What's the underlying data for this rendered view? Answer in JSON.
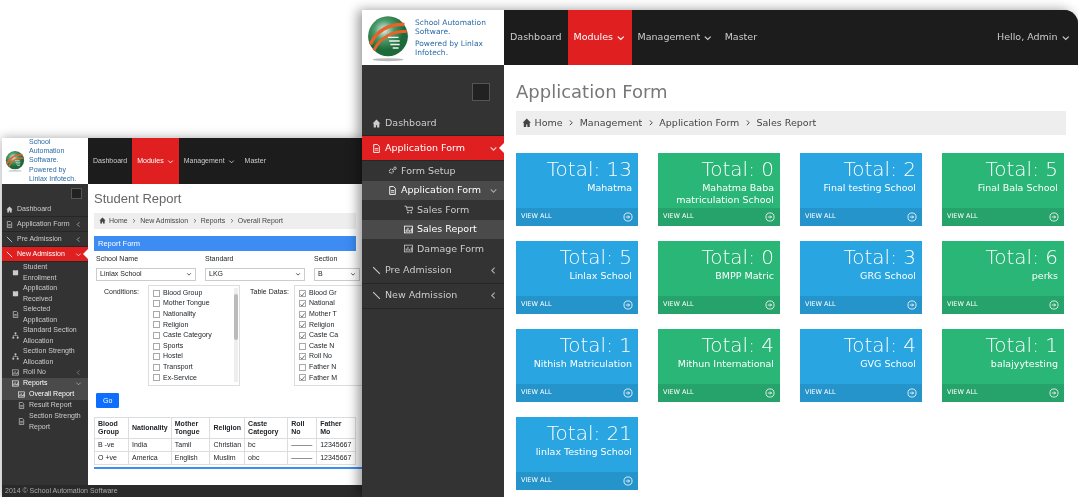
{
  "back_window": {
    "logo": {
      "title": "School Automation Software.",
      "subtitle": "Powered by Linlax Infotech."
    },
    "nav": [
      {
        "label": "Dashboard",
        "selected": false,
        "dropdown": false
      },
      {
        "label": "Modules",
        "selected": true,
        "dropdown": true
      },
      {
        "label": "Management",
        "selected": false,
        "dropdown": true
      },
      {
        "label": "Master",
        "selected": false,
        "dropdown": false
      }
    ],
    "sidebar": [
      {
        "label": "Dashboard",
        "kind": "home",
        "selected": false
      },
      {
        "label": "Application Form",
        "kind": "doc",
        "selected": false,
        "expanded": false
      },
      {
        "label": "Pre Admission",
        "kind": "pen",
        "selected": false,
        "expanded": false
      },
      {
        "label": "New Admission",
        "kind": "pen",
        "selected": true,
        "expanded": true,
        "children": [
          {
            "label": "Student Enrollment",
            "kind": "book",
            "selected": false
          },
          {
            "label": "Application Received",
            "kind": "book",
            "selected": false
          },
          {
            "label": "Selected Application",
            "kind": "doc",
            "selected": false
          },
          {
            "label": "Standard Section Allocation",
            "kind": "tree",
            "selected": false
          },
          {
            "label": "Section Strength Allocation",
            "kind": "tree",
            "selected": false
          },
          {
            "label": "Roll No",
            "kind": "chart",
            "selected": false,
            "expanded": false
          },
          {
            "label": "Reports",
            "kind": "chart",
            "selected": true,
            "expanded": true,
            "children": [
              {
                "label": "Overall Report",
                "kind": "chart",
                "selected": true
              },
              {
                "label": "Result Report",
                "kind": "doc",
                "selected": false
              },
              {
                "label": "Section Strength Report",
                "kind": "doc",
                "selected": false
              }
            ]
          }
        ]
      }
    ],
    "page_title": "Student Report",
    "breadcrumb": [
      "Home",
      "New Admission",
      "Reports",
      "Overall Report"
    ],
    "report_form": {
      "title": "Report Form",
      "fields": [
        {
          "label": "School Name",
          "value": "Linlax School"
        },
        {
          "label": "Standard",
          "value": "LKG"
        },
        {
          "label": "Section",
          "value": "B"
        }
      ],
      "conditions": {
        "label": "Conditions:",
        "options": [
          {
            "label": "Blood Group",
            "checked": false
          },
          {
            "label": "Mother Tongue",
            "checked": false
          },
          {
            "label": "Nationality",
            "checked": false
          },
          {
            "label": "Religion",
            "checked": false
          },
          {
            "label": "Caste Category",
            "checked": false
          },
          {
            "label": "Sports",
            "checked": false
          },
          {
            "label": "Hostel",
            "checked": false
          },
          {
            "label": "Transport",
            "checked": false
          },
          {
            "label": "Ex-Service",
            "checked": false
          }
        ]
      },
      "table_datas": {
        "label": "Table Datas:",
        "options": [
          {
            "label": "Blood Gr",
            "checked": true
          },
          {
            "label": "National",
            "checked": true
          },
          {
            "label": "Mother T",
            "checked": true
          },
          {
            "label": "Religion",
            "checked": true
          },
          {
            "label": "Caste Ca",
            "checked": true
          },
          {
            "label": "Caste N",
            "checked": false
          },
          {
            "label": "Roll No",
            "checked": true
          },
          {
            "label": "Father N",
            "checked": false
          },
          {
            "label": "Father M",
            "checked": true
          }
        ]
      },
      "button": "Go"
    },
    "table": {
      "columns": [
        "Blood Group",
        "Nationality",
        "Mother Tongue",
        "Religion",
        "Caste Category",
        "Roll No",
        "Father Mo"
      ],
      "rows": [
        [
          "B -ve",
          "India",
          "Tamil",
          "Christian",
          "bc",
          "———",
          "12345667"
        ],
        [
          "O +ve",
          "America",
          "English",
          "Muslim",
          "obc",
          "———",
          "12345667"
        ]
      ]
    },
    "footer": "2014 © School Automation Software"
  },
  "front_window": {
    "logo": {
      "title": "School Automation Software.",
      "subtitle": "Powered by Linlax Infotech."
    },
    "nav": [
      {
        "label": "Dashboard",
        "selected": false,
        "dropdown": false
      },
      {
        "label": "Modules",
        "selected": true,
        "dropdown": true
      },
      {
        "label": "Management",
        "selected": false,
        "dropdown": true
      },
      {
        "label": "Master",
        "selected": false,
        "dropdown": false
      }
    ],
    "user_menu": "Hello, Admin",
    "sidebar": [
      {
        "label": "Dashboard",
        "kind": "home",
        "selected": false
      },
      {
        "label": "Application Form",
        "kind": "doc",
        "selected": true,
        "expanded": true,
        "children": [
          {
            "label": "Form Setup",
            "kind": "gear",
            "selected": false
          },
          {
            "label": "Application Form",
            "kind": "doc",
            "selected": true,
            "expanded": true,
            "children": [
              {
                "label": "Sales Form",
                "kind": "cart",
                "selected": false
              },
              {
                "label": "Sales Report",
                "kind": "chart",
                "selected": true
              },
              {
                "label": "Damage Form",
                "kind": "chart",
                "selected": false
              }
            ]
          }
        ]
      },
      {
        "label": "Pre Admission",
        "kind": "pen",
        "selected": false,
        "expanded": false
      },
      {
        "label": "New Admission",
        "kind": "pen",
        "selected": false,
        "expanded": false
      }
    ],
    "page_title": "Application Form",
    "breadcrumb": [
      "Home",
      "Management",
      "Application Form",
      "Sales Report"
    ],
    "tiles": [
      {
        "total": "Total: 13",
        "name": "Mahatma",
        "link": "VIEW ALL",
        "color": "#29a5e2"
      },
      {
        "total": "Total: 0",
        "name": "Mahatma Baba matriculation School",
        "link": "VIEW ALL",
        "color": "#2ab677"
      },
      {
        "total": "Total: 2",
        "name": "Final testing School",
        "link": "VIEW ALL",
        "color": "#29a5e2"
      },
      {
        "total": "Total: 5",
        "name": "Final Bala School",
        "link": "VIEW ALL",
        "color": "#2ab677"
      },
      {
        "total": "Total: 5",
        "name": "Linlax School",
        "link": "VIEW ALL",
        "color": "#29a5e2"
      },
      {
        "total": "Total: 0",
        "name": "BMPP Matric",
        "link": "VIEW ALL",
        "color": "#2ab677"
      },
      {
        "total": "Total: 3",
        "name": "GRG School",
        "link": "VIEW ALL",
        "color": "#29a5e2"
      },
      {
        "total": "Total: 6",
        "name": "perks",
        "link": "VIEW ALL",
        "color": "#2ab677"
      },
      {
        "total": "Total: 1",
        "name": "Nithish Matriculation",
        "link": "VIEW ALL",
        "color": "#29a5e2"
      },
      {
        "total": "Total: 4",
        "name": "Mithun International",
        "link": "VIEW ALL",
        "color": "#2ab677"
      },
      {
        "total": "Total: 4",
        "name": "GVG School",
        "link": "VIEW ALL",
        "color": "#29a5e2"
      },
      {
        "total": "Total: 1",
        "name": "balajyytesting",
        "link": "VIEW ALL",
        "color": "#2ab677"
      },
      {
        "total": "Total: 21",
        "name": "linlax Testing School",
        "link": "VIEW ALL",
        "color": "#29a5e2"
      }
    ]
  }
}
